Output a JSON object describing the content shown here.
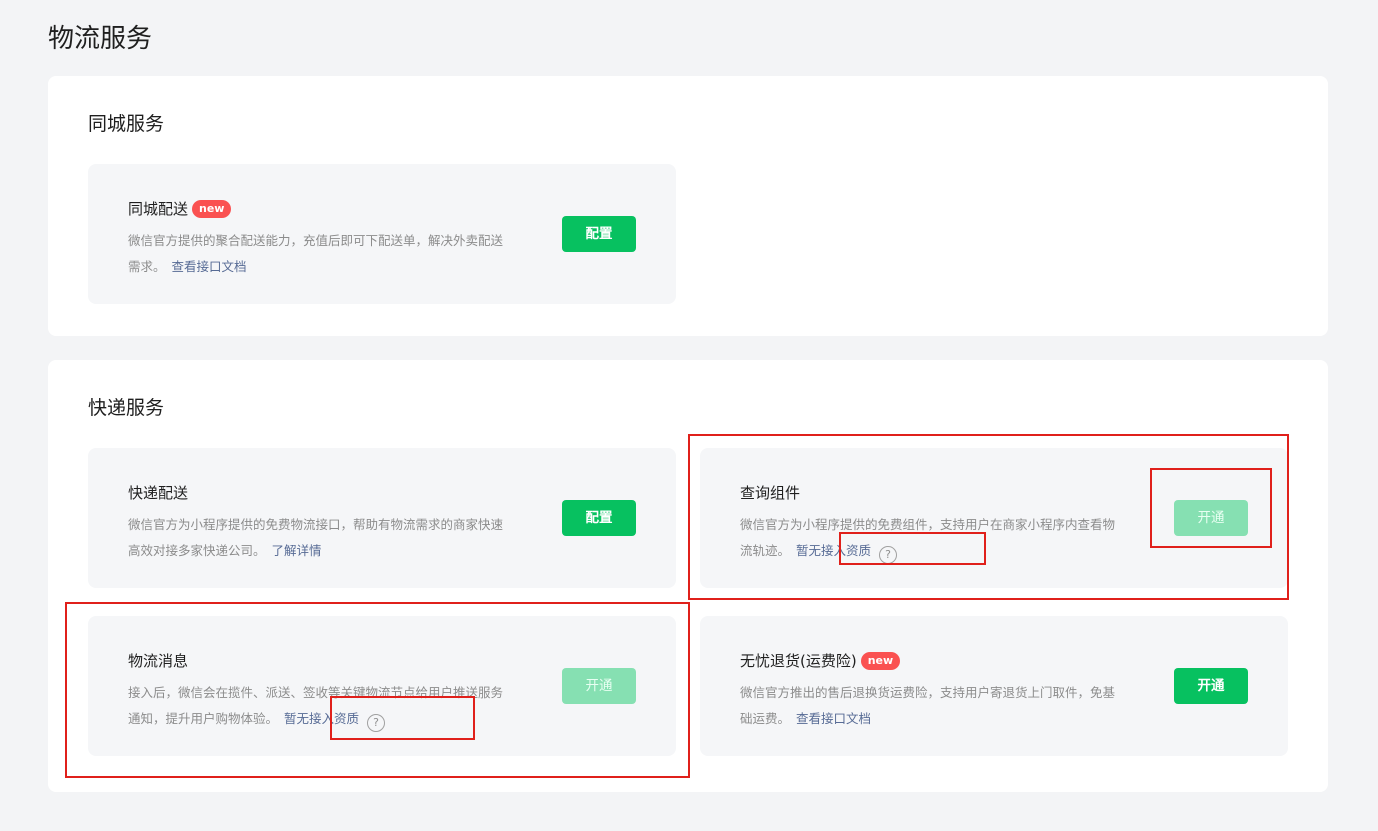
{
  "page_title": "物流服务",
  "sections": {
    "same_city": {
      "title": "同城服务",
      "cards": {
        "delivery": {
          "title": "同城配送",
          "badge": "new",
          "desc": "微信官方提供的聚合配送能力，充值后即可下配送单，解决外卖配送需求。",
          "link": "查看接口文档",
          "button": "配置",
          "button_state": "enabled"
        }
      }
    },
    "express": {
      "title": "快递服务",
      "cards": {
        "express_delivery": {
          "title": "快递配送",
          "desc": "微信官方为小程序提供的免费物流接口，帮助有物流需求的商家快速高效对接多家快递公司。",
          "link": "了解详情",
          "button": "配置",
          "button_state": "enabled"
        },
        "query_component": {
          "title": "查询组件",
          "desc": "微信官方为小程序提供的免费组件，支持用户在商家小程序内查看物流轨迹。",
          "link": "暂无接入资质",
          "button": "开通",
          "button_state": "disabled"
        },
        "logistics_message": {
          "title": "物流消息",
          "desc": "接入后，微信会在揽件、派送、签收等关键物流节点给用户推送服务通知，提升用户购物体验。",
          "link": "暂无接入资质",
          "button": "开通",
          "button_state": "disabled"
        },
        "return_insurance": {
          "title": "无忧退货(运费险)",
          "badge": "new",
          "desc": "微信官方推出的售后退换货运费险，支持用户寄退货上门取件，免基础运费。",
          "link": "查看接口文档",
          "button": "开通",
          "button_state": "enabled"
        }
      }
    }
  },
  "icons": {
    "help": "?"
  },
  "colors": {
    "primary_green": "#07c160",
    "disabled_green": "#86e0b2",
    "link_blue": "#576b95",
    "badge_red": "#fa5151",
    "highlight_red": "#e0201b"
  }
}
